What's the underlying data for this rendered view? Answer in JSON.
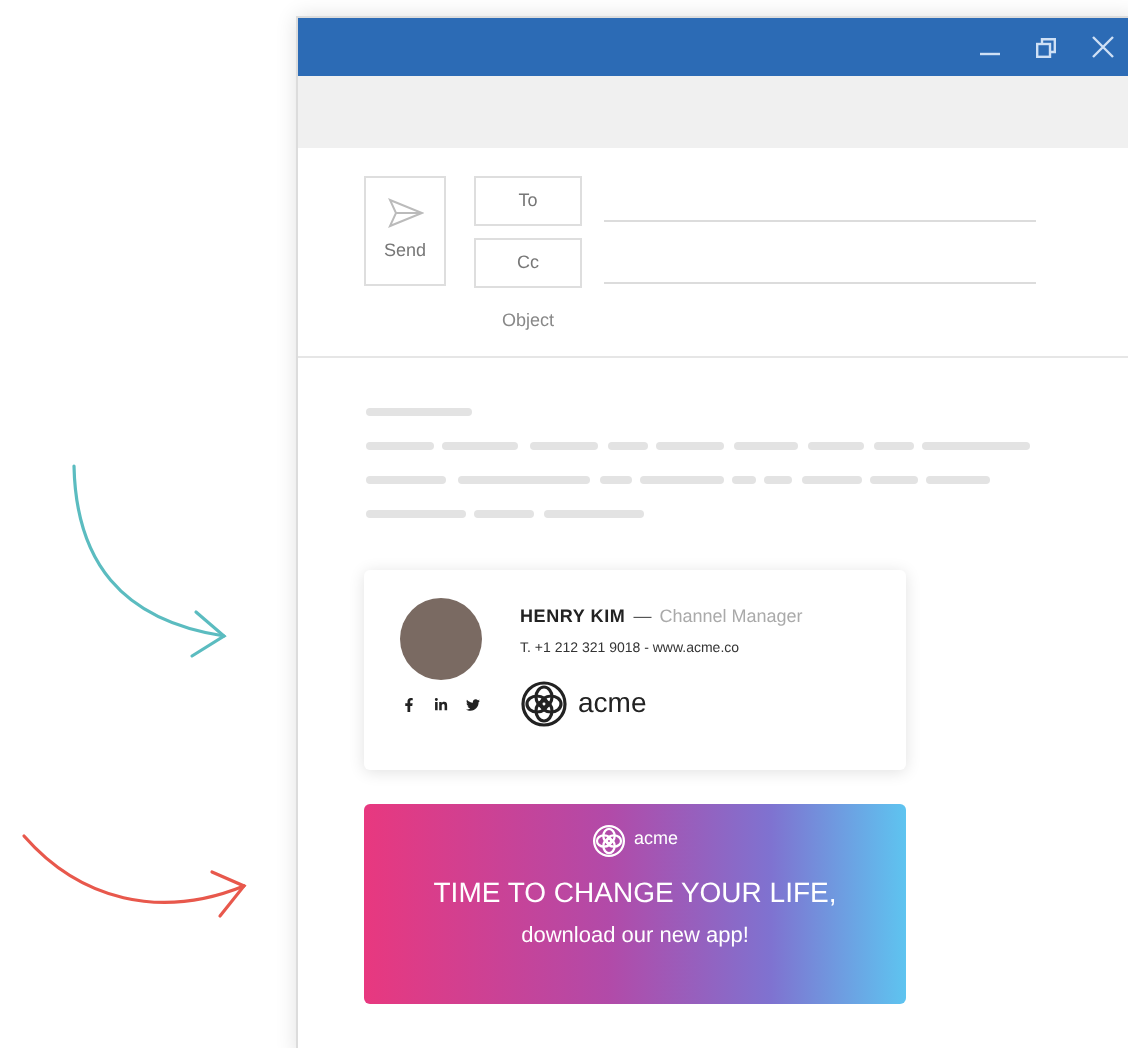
{
  "compose": {
    "send_label": "Send",
    "to_label": "To",
    "cc_label": "Cc",
    "object_label": "Object"
  },
  "signature": {
    "name": "HENRY KIM",
    "separator": "—",
    "role": "Channel Manager",
    "contact": "T. +1 212 321 9018 - www.acme.co",
    "logo_text": "acme"
  },
  "banner": {
    "logo_text": "acme",
    "headline": "TIME TO CHANGE YOUR LIFE,",
    "subline": "download our new app!"
  }
}
